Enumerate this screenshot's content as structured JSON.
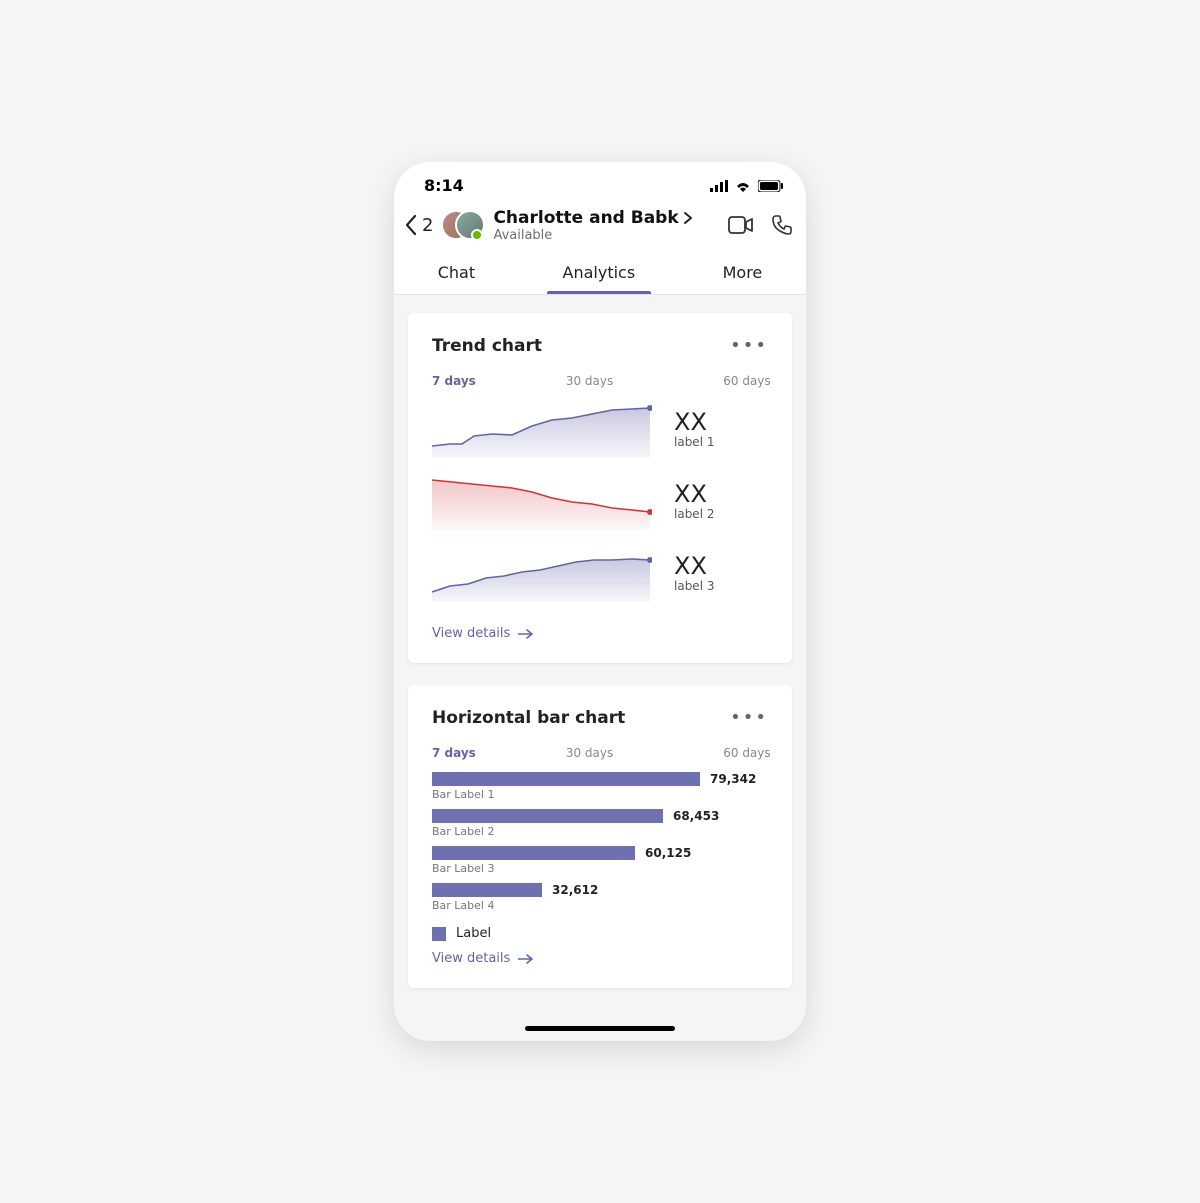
{
  "status": {
    "time": "8:14"
  },
  "header": {
    "back_count": "2",
    "title": "Charlotte and Babk",
    "subtitle": "Available"
  },
  "tabs": {
    "chat": "Chat",
    "analytics": "Analytics",
    "more": "More"
  },
  "range": {
    "d7": "7 days",
    "d30": "30 days",
    "d60": "60 days"
  },
  "card1": {
    "title": "Trend chart",
    "metrics": [
      {
        "value": "XX",
        "label": "label 1"
      },
      {
        "value": "XX",
        "label": "label 2"
      },
      {
        "value": "XX",
        "label": "label 3"
      }
    ],
    "view": "View details"
  },
  "card2": {
    "title": "Horizontal bar chart",
    "legend": "Label",
    "view": "View details"
  },
  "chart_data": [
    {
      "type": "area",
      "title": "Trend chart",
      "range_selected": "7 days",
      "series": [
        {
          "name": "label 1",
          "color": "#6264a7",
          "trend": "up",
          "x": [
            0,
            1,
            2,
            3,
            4,
            5,
            6,
            7,
            8,
            9,
            10,
            11,
            12
          ],
          "y": [
            20,
            22,
            22,
            30,
            32,
            31,
            38,
            42,
            44,
            46,
            48,
            49,
            50
          ]
        },
        {
          "name": "label 2",
          "color": "#d13438",
          "trend": "down",
          "x": [
            0,
            1,
            2,
            3,
            4,
            5,
            6,
            7,
            8,
            9,
            10,
            11,
            12
          ],
          "y": [
            48,
            47,
            46,
            44,
            43,
            42,
            40,
            38,
            36,
            34,
            33,
            32,
            30
          ]
        },
        {
          "name": "label 3",
          "color": "#6264a7",
          "trend": "up",
          "x": [
            0,
            1,
            2,
            3,
            4,
            5,
            6,
            7,
            8,
            9,
            10,
            11,
            12
          ],
          "y": [
            18,
            22,
            24,
            28,
            30,
            32,
            34,
            36,
            38,
            40,
            40,
            41,
            40
          ]
        }
      ],
      "ylim": [
        0,
        60
      ]
    },
    {
      "type": "bar",
      "orientation": "horizontal",
      "title": "Horizontal bar chart",
      "range_selected": "7 days",
      "categories": [
        "Bar Label 1",
        "Bar Label 2",
        "Bar Label 3",
        "Bar Label 4"
      ],
      "values": [
        79342,
        68453,
        60125,
        32612
      ],
      "value_labels": [
        "79,342",
        "68,453",
        "60,125",
        "32,612"
      ],
      "legend": [
        "Label"
      ],
      "color": "#6f70b0"
    }
  ]
}
